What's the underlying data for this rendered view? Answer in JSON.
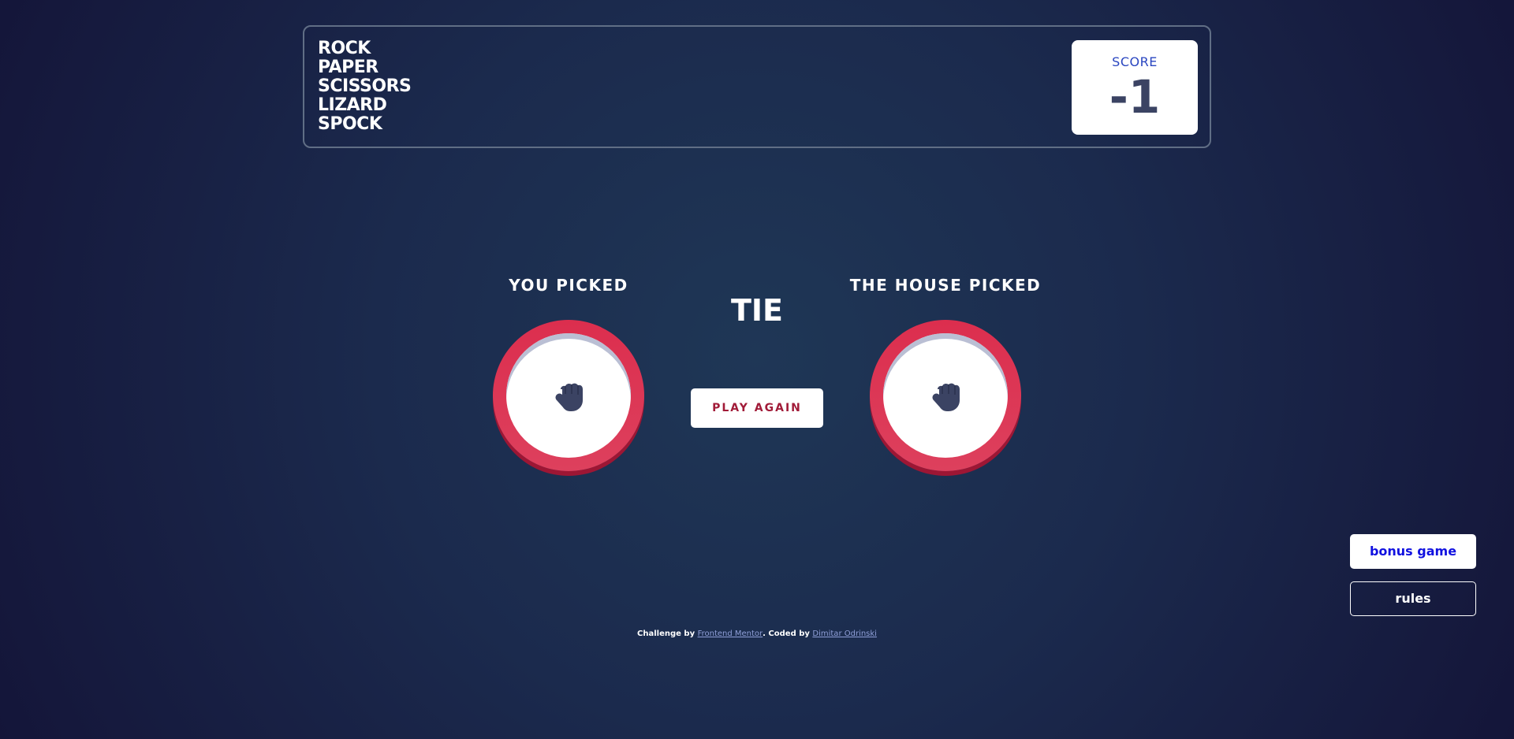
{
  "header": {
    "title_lines": [
      "ROCK",
      "PAPER",
      "SCISSORS",
      "LIZARD",
      "SPOCK"
    ],
    "score_label": "SCORE",
    "score_value": "-1"
  },
  "game": {
    "you_label": "YOU PICKED",
    "house_label": "THE HOUSE PICKED",
    "you_pick_icon": "rock-icon",
    "house_pick_icon": "rock-icon",
    "result": "TIE",
    "play_again_label": "PLAY AGAIN"
  },
  "side": {
    "bonus_label": "bonus game",
    "rules_label": "rules"
  },
  "footer": {
    "challenge_prefix": "Challenge by",
    "challenge_link": "Frontend Mentor",
    "coded_prefix": ". Coded by",
    "coded_link": "Dimitar Odrinski"
  },
  "colors": {
    "background": "#1f3756",
    "rock_rim": "#dc2e4e",
    "score_text": "#3b4363",
    "play_again_text": "#a11b38"
  }
}
